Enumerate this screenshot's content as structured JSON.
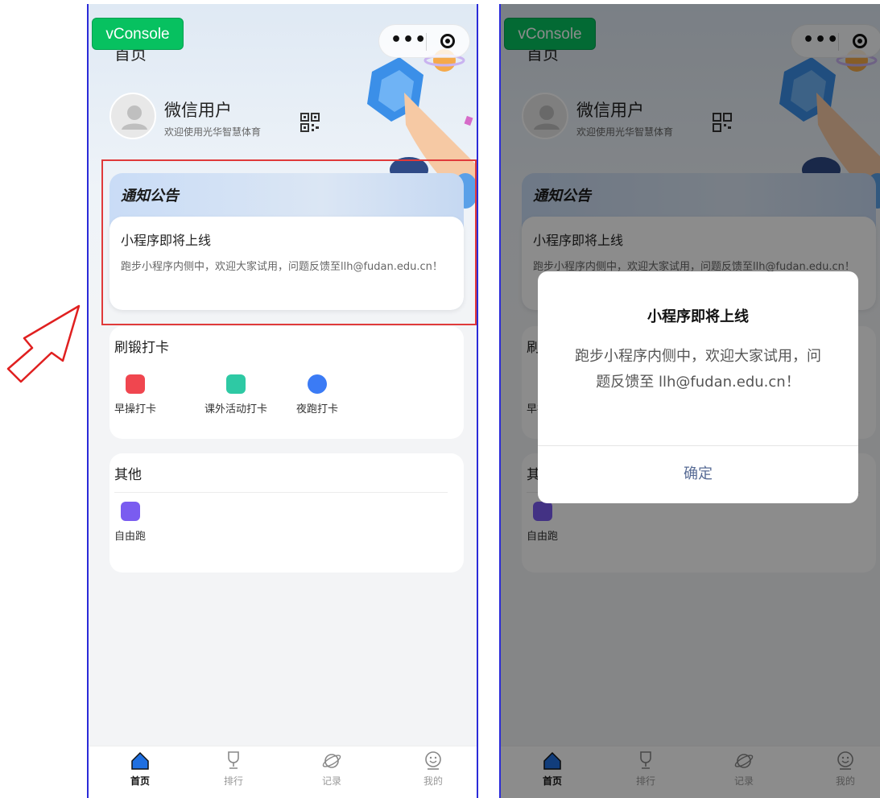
{
  "vconsole_label": "vConsole",
  "page_title": "首页",
  "capsule": {
    "more_icon": "more-dots-icon",
    "close_icon": "target-circle-icon"
  },
  "user": {
    "name": "微信用户",
    "welcome": "欢迎使用光华智慧体育"
  },
  "notice": {
    "title": "通知公告",
    "headline": "小程序即将上线",
    "body": "跑步小程序内侧中，欢迎大家试用，问题反馈至llh@fudan.edu.cn！"
  },
  "checkin": {
    "title": "刷锻打卡",
    "items": [
      {
        "label": "早操打卡",
        "icon": "morning-exercise-icon",
        "color": "#f0464f"
      },
      {
        "label": "课外活动打卡",
        "icon": "flag-icon",
        "color": "#2ec9a4"
      },
      {
        "label": "夜跑打卡",
        "icon": "moon-icon",
        "color": "#3b7bf5"
      }
    ]
  },
  "other": {
    "title": "其他",
    "items": [
      {
        "label": "自由跑",
        "icon": "runner-icon",
        "color": "#7a5cf0"
      }
    ]
  },
  "tabs": [
    {
      "label": "首页",
      "icon": "home-icon",
      "active": true
    },
    {
      "label": "排行",
      "icon": "trophy-icon",
      "active": false
    },
    {
      "label": "记录",
      "icon": "planet-icon",
      "active": false
    },
    {
      "label": "我的",
      "icon": "smile-icon",
      "active": false
    }
  ],
  "modal": {
    "title": "小程序即将上线",
    "body": "跑步小程序内侧中，欢迎大家试用，问题反馈至 llh@fudan.edu.cn！",
    "confirm_label": "确定"
  },
  "colors": {
    "highlight_border": "#e03a3a",
    "annotation_arrow": "#e02020",
    "tab_active": "#1f6fe0",
    "modal_button": "#576b95",
    "vconsole": "#07c160"
  }
}
